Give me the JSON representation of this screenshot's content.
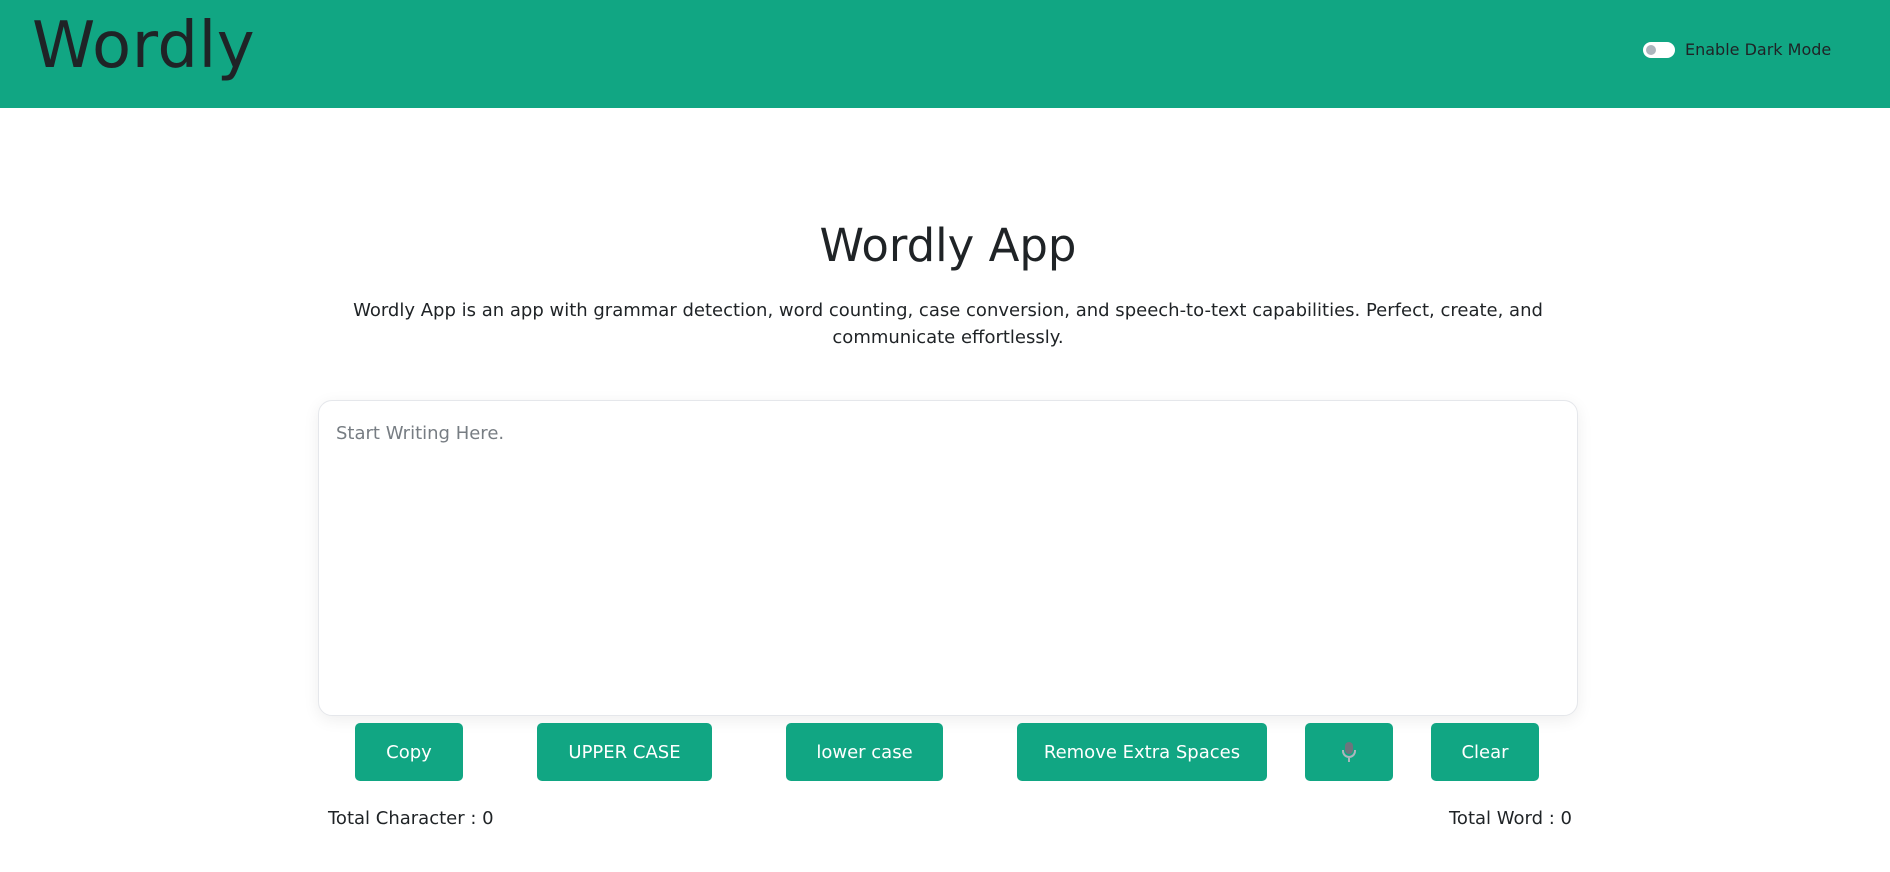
{
  "header": {
    "brand": "Wordly",
    "dark_mode_label": "Enable Dark Mode",
    "dark_mode_enabled": false
  },
  "main": {
    "title": "Wordly App",
    "description": "Wordly App is an app with grammar detection, word counting, case conversion, and speech-to-text capabilities. Perfect, create, and communicate effortlessly.",
    "editor": {
      "placeholder": "Start Writing Here.",
      "value": ""
    },
    "buttons": {
      "copy": "Copy",
      "upper": "UPPER CASE",
      "lower": "lower case",
      "spaces": "Remove Extra Spaces",
      "mic_icon": "microphone-icon",
      "clear": "Clear"
    },
    "stats": {
      "characters": "Total Character : 0",
      "words": "Total Word : 0"
    }
  },
  "colors": {
    "accent": "#11a683",
    "text": "#1f2326",
    "background": "#ffffff"
  }
}
